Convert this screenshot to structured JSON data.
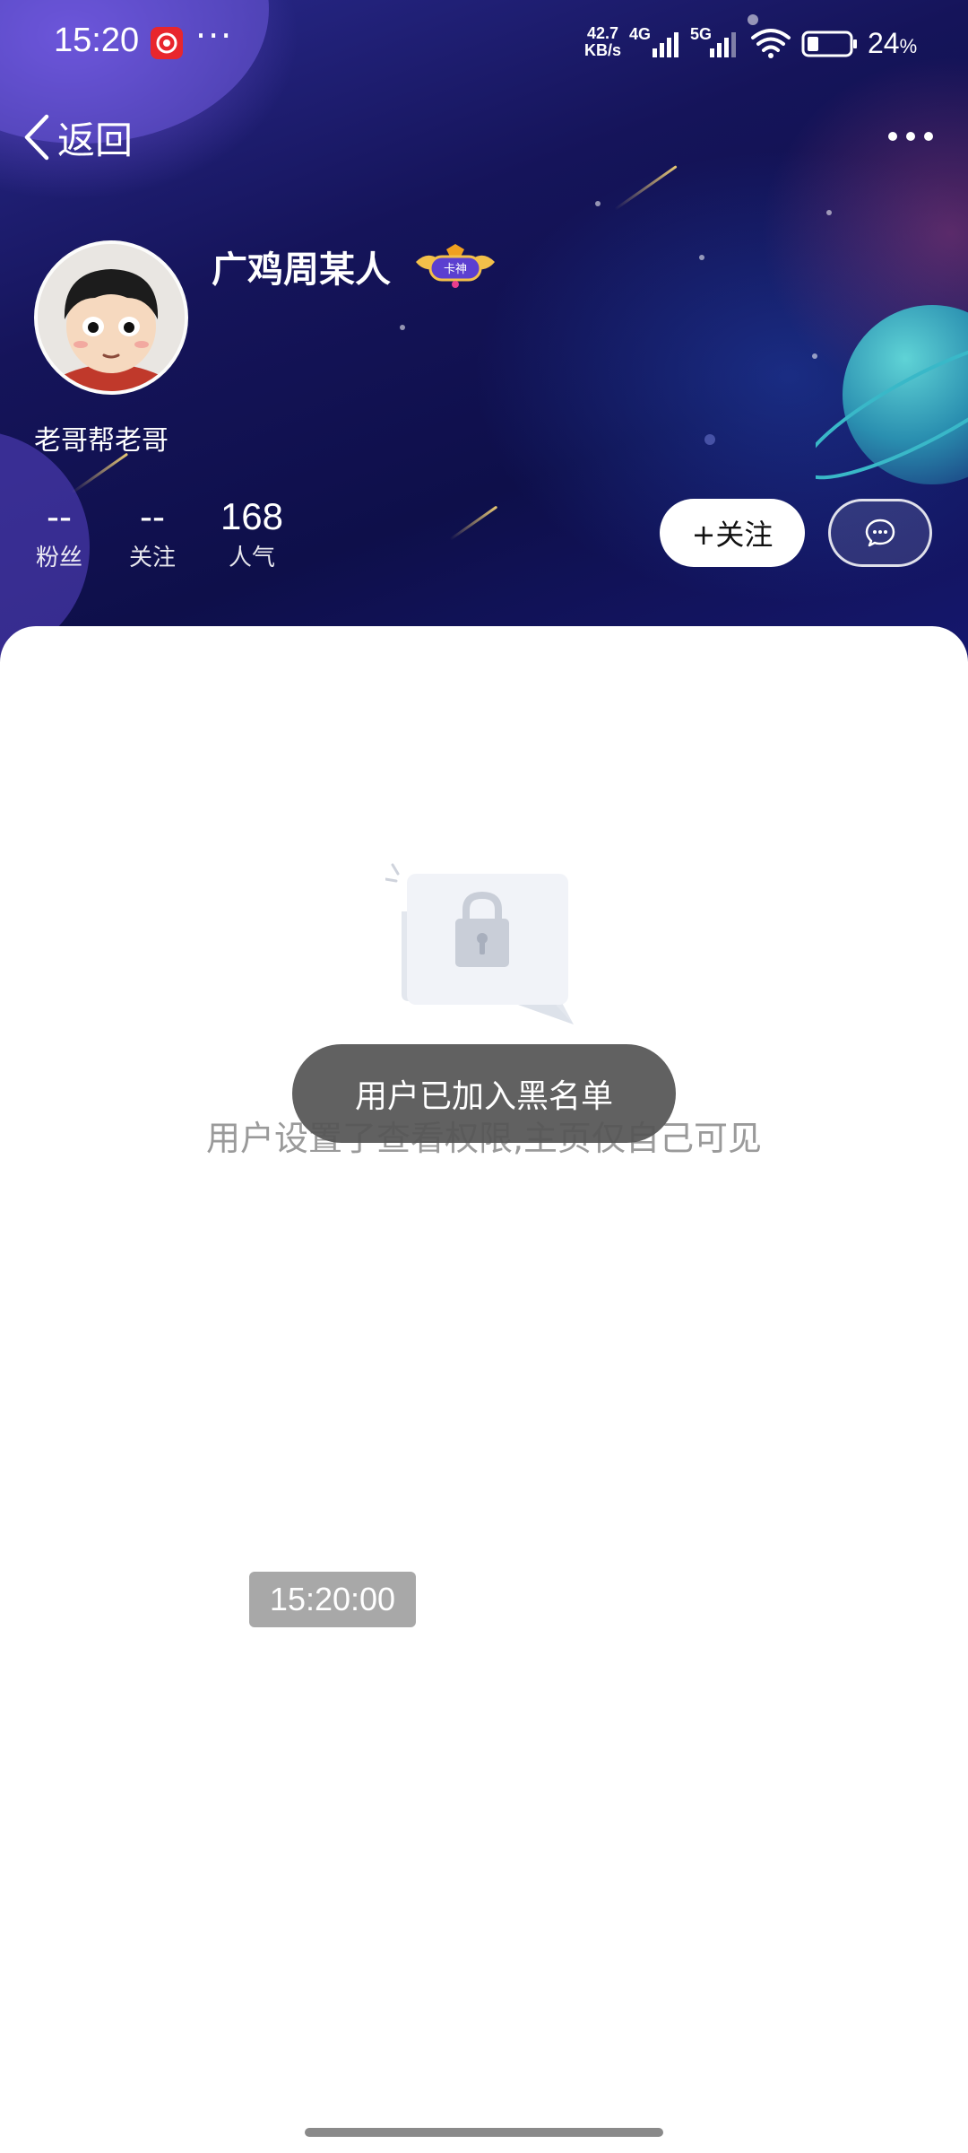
{
  "status_bar": {
    "time": "15:20",
    "more": "···",
    "net_speed_value": "42.7",
    "net_speed_unit": "KB/s",
    "net_4g": "4G",
    "net_5g": "5G",
    "battery_level": "24",
    "battery_unit": "%"
  },
  "nav": {
    "back_label": "返回"
  },
  "profile": {
    "username": "广鸡周某人",
    "badge_text": "卡神",
    "bio": "老哥帮老哥",
    "stats": [
      {
        "value": "--",
        "label": "粉丝"
      },
      {
        "value": "--",
        "label": "关注"
      },
      {
        "value": "168",
        "label": "人气"
      }
    ],
    "follow_label": "+关注"
  },
  "content": {
    "empty_message": "用户设置了查看权限,主页仅自己可见",
    "toast": "用户已加入黑名单",
    "timestamp": "15:20:00"
  },
  "colors": {
    "header_bg": "#15145a",
    "toast_bg": "#555555",
    "empty_text": "#9a9a9a"
  },
  "icons": [
    "back-chevron-icon",
    "more-dots-icon",
    "message-bubble-icon",
    "lock-icon",
    "wifi-icon",
    "battery-icon",
    "signal-icon"
  ]
}
